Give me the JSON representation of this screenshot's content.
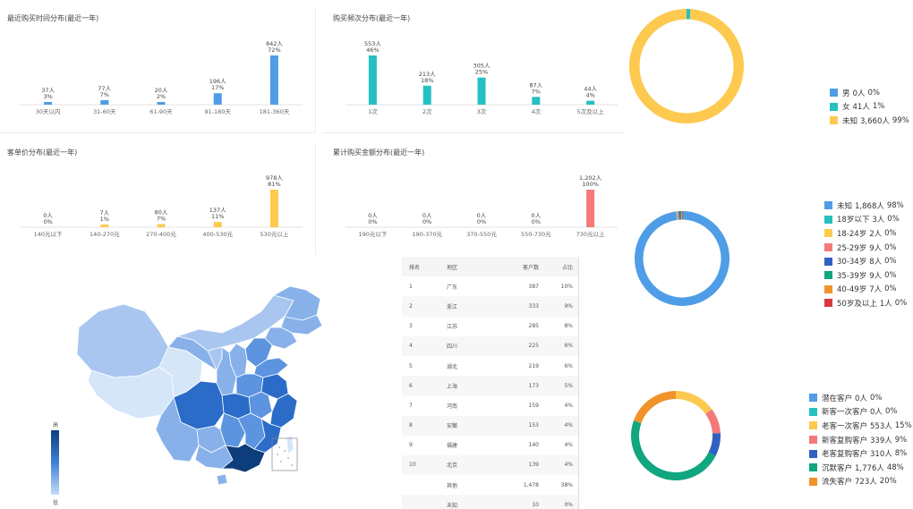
{
  "chart_data": [
    {
      "id": "recent",
      "type": "bar",
      "title": "最近购买时间分布(最近一年)",
      "categories": [
        "30天以内",
        "31-60天",
        "61-90天",
        "91-180天",
        "181-360天"
      ],
      "values": [
        37,
        77,
        20,
        196,
        842
      ],
      "value_labels": [
        "37人",
        "77人",
        "20人",
        "196人",
        "842人"
      ],
      "percent_labels": [
        "3%",
        "7%",
        "2%",
        "17%",
        "72%"
      ],
      "color": "#4e9de6",
      "ylim": [
        0,
        842
      ]
    },
    {
      "id": "frequency",
      "type": "bar",
      "title": "购买频次分布(最近一年)",
      "categories": [
        "1次",
        "2次",
        "3次",
        "4次",
        "5次及以上"
      ],
      "values": [
        553,
        213,
        305,
        87,
        44
      ],
      "value_labels": [
        "553人",
        "213人",
        "305人",
        "87人",
        "44人"
      ],
      "percent_labels": [
        "46%",
        "18%",
        "25%",
        "7%",
        "4%"
      ],
      "color": "#26c0c0",
      "ylim": [
        0,
        553
      ]
    },
    {
      "id": "unitprice",
      "type": "bar",
      "title": "客单价分布(最近一年)",
      "categories": [
        "140元以下",
        "140-270元",
        "270-400元",
        "400-530元",
        "530元以上"
      ],
      "values": [
        0,
        7,
        80,
        137,
        978
      ],
      "value_labels": [
        "0人",
        "7人",
        "80人",
        "137人",
        "978人"
      ],
      "percent_labels": [
        "0%",
        "1%",
        "7%",
        "11%",
        "81%"
      ],
      "color": "#fdc94f",
      "ylim": [
        0,
        978
      ]
    },
    {
      "id": "amount",
      "type": "bar",
      "title": "累计购买金额分布(最近一年)",
      "categories": [
        "190元以下",
        "190-370元",
        "370-550元",
        "550-730元",
        "730元以上"
      ],
      "values": [
        0,
        0,
        0,
        0,
        1202
      ],
      "value_labels": [
        "0人",
        "0人",
        "0人",
        "0人",
        "1,202人"
      ],
      "percent_labels": [
        "0%",
        "0%",
        "0%",
        "0%",
        "100%"
      ],
      "color": "#f47a7a",
      "ylim": [
        0,
        1202
      ]
    },
    {
      "id": "gender",
      "type": "pie",
      "labels": [
        "男",
        "女",
        "未知"
      ],
      "values": [
        0,
        41,
        3660
      ],
      "value_labels": [
        "0人",
        "41人",
        "3,660人"
      ],
      "percent_labels": [
        "0%",
        "1%",
        "99%"
      ],
      "colors": [
        "#4e9de6",
        "#26c0c0",
        "#fdc94f"
      ]
    },
    {
      "id": "age",
      "type": "pie",
      "labels": [
        "未知",
        "18岁以下",
        "18-24岁",
        "25-29岁",
        "30-34岁",
        "35-39岁",
        "40-49岁",
        "50岁及以上"
      ],
      "values": [
        1868,
        3,
        2,
        9,
        8,
        9,
        7,
        1
      ],
      "value_labels": [
        "1,868人",
        "3人",
        "2人",
        "9人",
        "8人",
        "9人",
        "7人",
        "1人"
      ],
      "percent_labels": [
        "98%",
        "0%",
        "0%",
        "0%",
        "0%",
        "0%",
        "0%",
        "0%"
      ],
      "colors": [
        "#4e9de6",
        "#26c0c0",
        "#fdc94f",
        "#f47a7a",
        "#2f62c0",
        "#10a67f",
        "#f0932b",
        "#d9363e"
      ]
    },
    {
      "id": "lifecycle",
      "type": "pie",
      "labels": [
        "潜在客户",
        "新客一次客户",
        "老客一次客户",
        "新客复购客户",
        "老客复购客户",
        "沉默客户",
        "流失客户"
      ],
      "values": [
        0,
        0,
        553,
        339,
        310,
        1776,
        723
      ],
      "value_labels": [
        "0人",
        "0人",
        "553人",
        "339人",
        "310人",
        "1,776人",
        "723人"
      ],
      "percent_labels": [
        "0%",
        "0%",
        "15%",
        "9%",
        "8%",
        "48%",
        "20%"
      ],
      "colors": [
        "#4e9de6",
        "#26c0c0",
        "#fdc94f",
        "#f47a7a",
        "#2f62c0",
        "#10a67f",
        "#f0932b"
      ]
    },
    {
      "id": "region_table",
      "type": "table",
      "headers": [
        "排名",
        "地区",
        "客户数",
        "占比"
      ],
      "rows": [
        [
          "1",
          "广东",
          "387",
          "10%"
        ],
        [
          "2",
          "浙江",
          "333",
          "9%"
        ],
        [
          "3",
          "江苏",
          "285",
          "8%"
        ],
        [
          "4",
          "四川",
          "225",
          "6%"
        ],
        [
          "5",
          "湖北",
          "219",
          "6%"
        ],
        [
          "6",
          "上海",
          "173",
          "5%"
        ],
        [
          "7",
          "河南",
          "159",
          "4%"
        ],
        [
          "8",
          "安徽",
          "153",
          "4%"
        ],
        [
          "9",
          "福建",
          "140",
          "4%"
        ],
        [
          "10",
          "北京",
          "139",
          "4%"
        ],
        [
          "",
          "其他",
          "1,478",
          "38%"
        ],
        [
          "",
          "未知",
          "10",
          "0%"
        ]
      ]
    }
  ],
  "map": {
    "scale_high": "高",
    "scale_low": "低",
    "colors": [
      "#0e3d7c",
      "#2a6cc8",
      "#5c94e0",
      "#88b1ea",
      "#a9c6f0",
      "#d6e6f9"
    ]
  }
}
